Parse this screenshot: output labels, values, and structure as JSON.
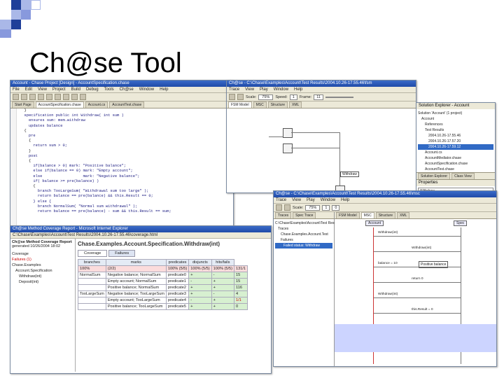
{
  "slide": {
    "title": "Ch@se Tool",
    "accent_colors": {
      "dark": "#1f3f99",
      "light": "#aab8e8",
      "mid": "#8899dd"
    }
  },
  "editor": {
    "window_title": "Account - Chase Project [Design] - AccountSpecification.chase",
    "menu": [
      "File",
      "Edit",
      "View",
      "Project",
      "Build",
      "Debug",
      "Tools",
      "Ch@se",
      "Window",
      "Help"
    ],
    "tabs": [
      "Start Page",
      "AccountSpecification.chase",
      "Account.cs",
      "AccountTest.chase"
    ],
    "active_tab": 1,
    "code_lines": [
      "  }",
      "",
      "  specification public int Withdraw( int sum )",
      "    ensures sum: mem.withdraw",
      "    updates balance",
      "",
      "  {",
      "    pre",
      "    {",
      "      return sum > 0;",
      "    }",
      "    post",
      "    {",
      "      if(balance > 0) mark: \"Positive balance\";",
      "      else if(balance == 0) mark: \"Empty account\";",
      "      else                  mark: \"Negative balance\";",
      "",
      "      if( balance >= pre(balance) )",
      "      {",
      "        branch TooLargeSum( \"Withdrawal sum too large\" );",
      "        return balance == pre(balance) && this.Result == 0;",
      "      } else {",
      "        branch NormalSum( \"Normal sum withdrawal\" );",
      "        return balance == pre(balance) - sum && this.Result == sum;"
    ]
  },
  "diagram": {
    "window_title": "Ch@se - C:\\Chase\\Examples\\Account\\Test Results\\2004.10.26-17.55.46\\fsm",
    "menu": [
      "Trace",
      "View",
      "Play",
      "Window",
      "Help"
    ],
    "scale_label": "Scale:",
    "scale_value": "75%",
    "speed_label": "Speed:",
    "speed_value": "1",
    "frame_label": "Frame:",
    "frame_value": "11",
    "tabs": [
      "FSM Model",
      "MSC",
      "Structure",
      "XML"
    ],
    "node_label": "Withdraw"
  },
  "solution": {
    "title": "Solution Explorer - Account",
    "items": [
      "Solution 'Account' (1 project)",
      "Account",
      "References",
      "Test Results",
      "2004.10.26-17.55.46",
      "2004.10.26-17.57.20",
      "2004.10.26-17.59.12",
      "Account.cs",
      "AccountMediator.chase",
      "AccountSpecification.chase",
      "AccountTest.chase"
    ],
    "tabs": [
      "Solution Explorer",
      "Class View"
    ],
    "properties_title": "Properties",
    "properties_value": "Withdraw"
  },
  "msc": {
    "window_title": "Ch@se - C:\\Chase\\Examples\\Account\\Test Results\\2004.10.26-17.55.46\\msc",
    "menu": [
      "Trace",
      "View",
      "Play",
      "Window",
      "Help"
    ],
    "scale_label": "Scale:",
    "scale_value": "75%",
    "speed_value": "1",
    "frame_value": "0",
    "tree_tabs": [
      "Traces",
      "Spec Trace"
    ],
    "tree": [
      "C:\\Chase\\Examples\\Account\\Test Results\\...",
      "Traces",
      "Chase.Examples.Account.Test",
      "Failures",
      "Failed status: Withdraw"
    ],
    "diagram_tabs": [
      "FSM Model",
      "MSC",
      "Structure",
      "XML"
    ],
    "lifelines": [
      "Account",
      "Spec"
    ],
    "messages": [
      "Withdraw(int)",
      "Withdraw(int)",
      "balance = 10",
      "return 0",
      "Withdraw(int)",
      "this.Result = 0"
    ],
    "note": "Positive balance"
  },
  "coverage": {
    "window_title": "Ch@se Method Coverage Report - Microsoft Internet Explorer",
    "heading": "Ch@se Method Coverage Report",
    "generated": "generated 10/26/2004 18:02",
    "address": "C:\\Chase\\Examples\\Account\\Test Results\\2004.10.26-17.55.46\\coverage.html",
    "tree": [
      "Coverage",
      "Failures (1)",
      "Chase.Examples",
      "Account.Specification",
      "Withdraw(int)",
      "Deposit(int)"
    ],
    "page_title": "Chase.Examples.Account.Specification.Withdraw(int)",
    "tabs": [
      "Coverage",
      "Failures"
    ],
    "columns": [
      "branches",
      "marks",
      "predicates",
      "disjuncts",
      "hits/fails"
    ],
    "rows": [
      [
        "100%",
        "(2/2)",
        "100% (5/5)",
        "100% (5/5)",
        "100% (5/5)",
        "131/1"
      ],
      [
        "NormalSum",
        "Negative balance; NormalSum",
        "predicate0",
        "+",
        "-",
        "15"
      ],
      [
        "",
        "Empty account; NormalSum",
        "predicate1",
        "-",
        "+",
        "15"
      ],
      [
        "",
        "Positive balance; NormalSum",
        "predicate2",
        "+",
        "+",
        "116"
      ],
      [
        "TooLargeSum",
        "Negative balance; TooLargeSum",
        "predicate3",
        "+",
        "-",
        "4"
      ],
      [
        "",
        "Empty account; TooLargeSum",
        "predicate4",
        "-",
        "+",
        "1/1"
      ],
      [
        "",
        "Positive balance; TooLargeSum",
        "predicate5",
        "+",
        "+",
        "0"
      ]
    ]
  }
}
